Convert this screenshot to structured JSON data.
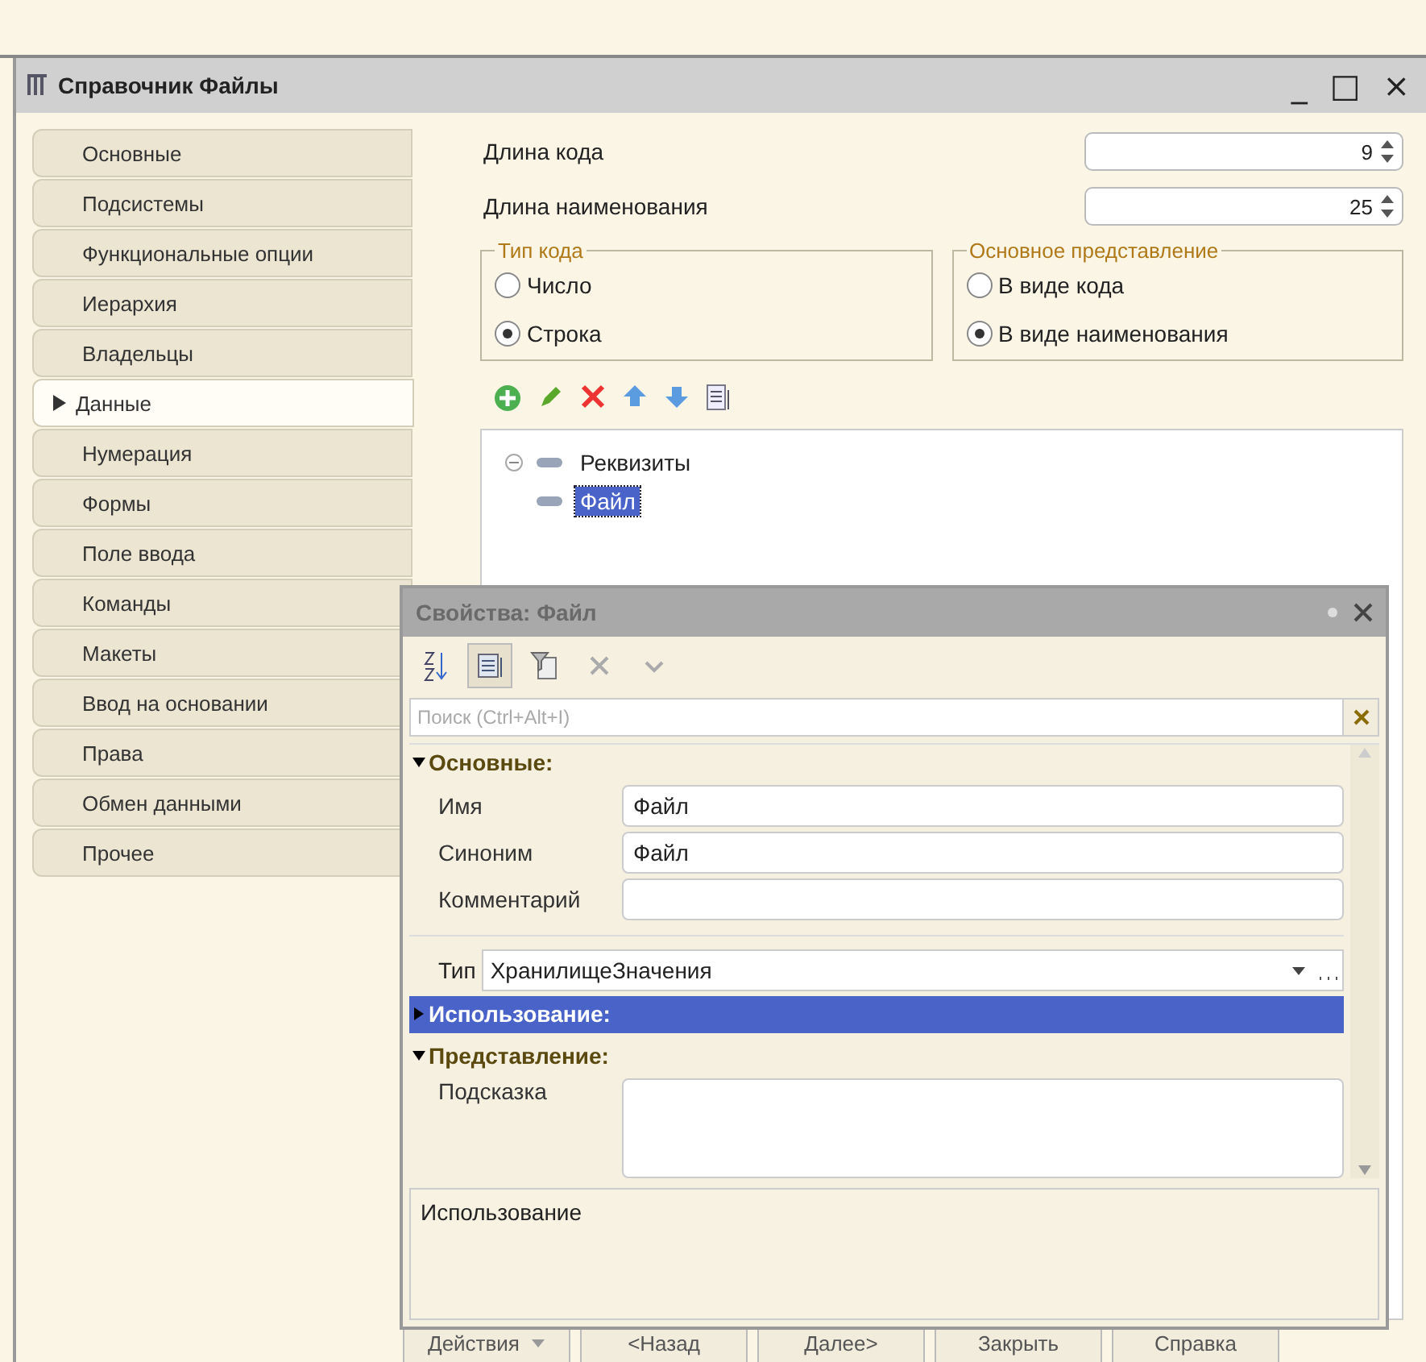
{
  "window": {
    "title": "Справочник Файлы",
    "buttons": [
      "_",
      "□",
      "×"
    ]
  },
  "tabs": [
    {
      "label": "Основные",
      "selected": false
    },
    {
      "label": "Подсистемы",
      "selected": false
    },
    {
      "label": "Функциональные опции",
      "selected": false
    },
    {
      "label": "Иерархия",
      "selected": false
    },
    {
      "label": "Владельцы",
      "selected": false
    },
    {
      "label": "Данные",
      "selected": true
    },
    {
      "label": "Нумерация",
      "selected": false
    },
    {
      "label": "Формы",
      "selected": false
    },
    {
      "label": "Поле ввода",
      "selected": false
    },
    {
      "label": "Команды",
      "selected": false
    },
    {
      "label": "Макеты",
      "selected": false
    },
    {
      "label": "Ввод на основании",
      "selected": false
    },
    {
      "label": "Права",
      "selected": false
    },
    {
      "label": "Обмен данными",
      "selected": false
    },
    {
      "label": "Прочее",
      "selected": false
    }
  ],
  "numbers": [
    {
      "label": "Длина кода",
      "value": "9"
    },
    {
      "label": "Длина наименования",
      "value": "25"
    }
  ],
  "groups": [
    {
      "title": "Тип кода",
      "options": [
        {
          "label": "Число",
          "selected": false
        },
        {
          "label": "Строка",
          "selected": true
        }
      ]
    },
    {
      "title": "Основное представление",
      "options": [
        {
          "label": "В виде кода",
          "selected": false
        },
        {
          "label": "В виде наименования",
          "selected": true
        }
      ]
    }
  ],
  "tree": [
    {
      "label": "Реквизиты",
      "expanded": true,
      "selected": false,
      "children": [
        {
          "label": "Файл",
          "selected": true
        }
      ]
    }
  ],
  "properties": {
    "title": "Свойства: Файл",
    "search": {
      "placeholder": "Поиск (Ctrl+Alt+I)"
    },
    "rows": [
      {
        "kind": "section",
        "label": "Основные:",
        "expanded": true,
        "selected": false
      },
      {
        "kind": "text",
        "label": "Имя",
        "value": "Файл"
      },
      {
        "kind": "text",
        "label": "Синоним",
        "value": "Файл"
      },
      {
        "kind": "text",
        "label": "Комментарий",
        "value": ""
      },
      {
        "kind": "dropdown",
        "label": "Тип",
        "value": "ХранилищеЗначения"
      },
      {
        "kind": "section",
        "label": "Использование:",
        "expanded": false,
        "selected": true
      },
      {
        "kind": "section",
        "label": "Представление:",
        "expanded": true,
        "selected": false
      },
      {
        "kind": "multiline",
        "label": "Подсказка",
        "value": ""
      }
    ],
    "description": "Использование"
  },
  "buttons": [
    {
      "label": "Действия",
      "menu": true
    },
    {
      "label": "<Назад",
      "menu": false
    },
    {
      "label": "Далее>",
      "menu": false
    },
    {
      "label": "Закрыть",
      "menu": false
    },
    {
      "label": "Справка",
      "menu": false
    }
  ]
}
